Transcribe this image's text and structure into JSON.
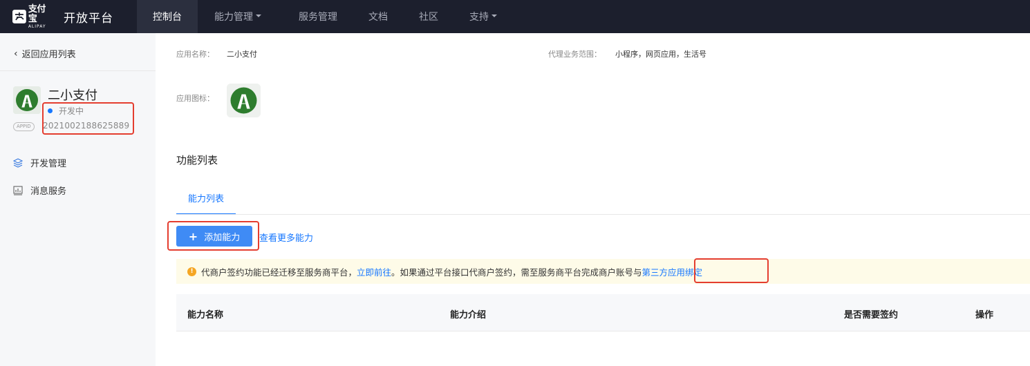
{
  "topbar": {
    "logo_zh": "支付宝",
    "logo_en": "ALIPAY",
    "title": "开放平台",
    "nav": [
      {
        "label": "控制台",
        "active": true,
        "dropdown": false
      },
      {
        "label": "能力管理",
        "active": false,
        "dropdown": true
      },
      {
        "label": "服务管理",
        "active": false,
        "dropdown": false
      },
      {
        "label": "文档",
        "active": false,
        "dropdown": false
      },
      {
        "label": "社区",
        "active": false,
        "dropdown": false
      },
      {
        "label": "支持",
        "active": false,
        "dropdown": true
      }
    ]
  },
  "sidebar": {
    "back_label": "返回应用列表",
    "app_name": "二小支付",
    "status": "开发中",
    "appid_badge": "APPID",
    "appid": "2021002188625889",
    "menu": [
      {
        "label": "开发管理",
        "icon": "layers-icon"
      },
      {
        "label": "消息服务",
        "icon": "chart-icon"
      }
    ]
  },
  "main": {
    "app_name_label": "应用名称：",
    "app_name_value": "二小支付",
    "scope_label": "代理业务范围：",
    "scope_value": "小程序，网页应用，生活号",
    "app_icon_label": "应用图标：",
    "section_title": "功能列表",
    "tab_label": "能力列表",
    "add_button": "添加能力",
    "more_link": "查看更多能力",
    "alert": {
      "text1": "代商户签约功能已经迁移至服务商平台，",
      "link1": "立即前往",
      "text2": "。如果通过平台接口代商户签约，需至服务商平台完成商户账号与",
      "link2": "第三方应用绑定"
    },
    "table_headers": [
      "能力名称",
      "能力介绍",
      "是否需要签约",
      "操作"
    ]
  },
  "colors": {
    "topbar_bg": "#1c1f2d",
    "accent": "#1677ff",
    "button_bg": "#3f8bf5",
    "highlight_box": "#e43d2f",
    "alert_bg": "#fefbe8"
  }
}
